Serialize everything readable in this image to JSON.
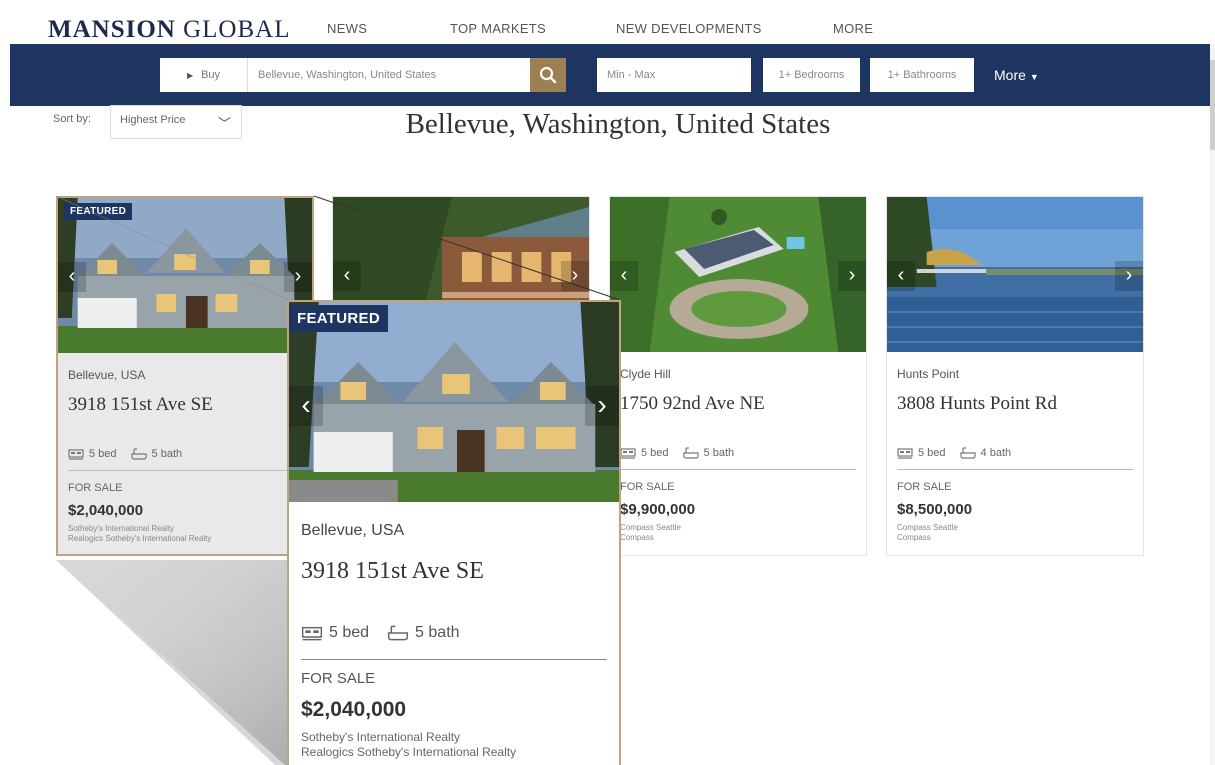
{
  "brand": {
    "bold": "MANSION",
    "light": " GLOBAL"
  },
  "nav": {
    "news": "NEWS",
    "top_markets": "TOP MARKETS",
    "new_developments": "NEW DEVELOPMENTS",
    "more": "MORE"
  },
  "search": {
    "mode": "Buy",
    "location": "Bellevue, Washington, United States",
    "price": "Min - Max",
    "bedrooms": "1+ Bedrooms",
    "bathrooms": "1+ Bathrooms",
    "more": "More"
  },
  "sort": {
    "label": "Sort by:",
    "value": "Highest Price"
  },
  "page_title": "Bellevue, Washington, United States",
  "colors": {
    "navy": "#1e3461",
    "gold": "#9d7f54",
    "highlight_border": "#bfa57f"
  },
  "listings": [
    {
      "featured": "FEATURED",
      "city": "Bellevue, USA",
      "address": "3918 151st Ave SE",
      "beds": "5 bed",
      "baths": "5 bath",
      "status": "FOR SALE",
      "price": "$2,040,000",
      "agent1": "Sotheby's International Realty",
      "agent2": "Realogics Sotheby's International Realty"
    },
    {
      "featured": "",
      "city": "",
      "address": "",
      "beds": "",
      "baths": "",
      "status": "",
      "price": "",
      "agent1": "",
      "agent2": ""
    },
    {
      "featured": "",
      "city": "Clyde Hill",
      "address": "1750 92nd Ave NE",
      "beds": "5 bed",
      "baths": "5 bath",
      "status": "FOR SALE",
      "price": "$9,900,000",
      "agent1": "Compass Seattle",
      "agent2": "Compass"
    },
    {
      "featured": "",
      "city": "Hunts Point",
      "address": "3808 Hunts Point Rd",
      "beds": "5 bed",
      "baths": "4 bath",
      "status": "FOR SALE",
      "price": "$8,500,000",
      "agent1": "Compass Seattle",
      "agent2": "Compass"
    }
  ],
  "zoom": {
    "featured": "FEATURED",
    "city": "Bellevue, USA",
    "address": "3918 151st Ave SE",
    "beds": "5 bed",
    "baths": "5 bath",
    "status": "FOR SALE",
    "price": "$2,040,000",
    "agent1": "Sotheby's International Realty",
    "agent2": "Realogics Sotheby's International Realty"
  },
  "icons": {
    "bed": "bed-icon",
    "bath": "bathtub-icon",
    "search": "search-icon",
    "prev": "chevron-left-icon",
    "next": "chevron-right-icon"
  }
}
